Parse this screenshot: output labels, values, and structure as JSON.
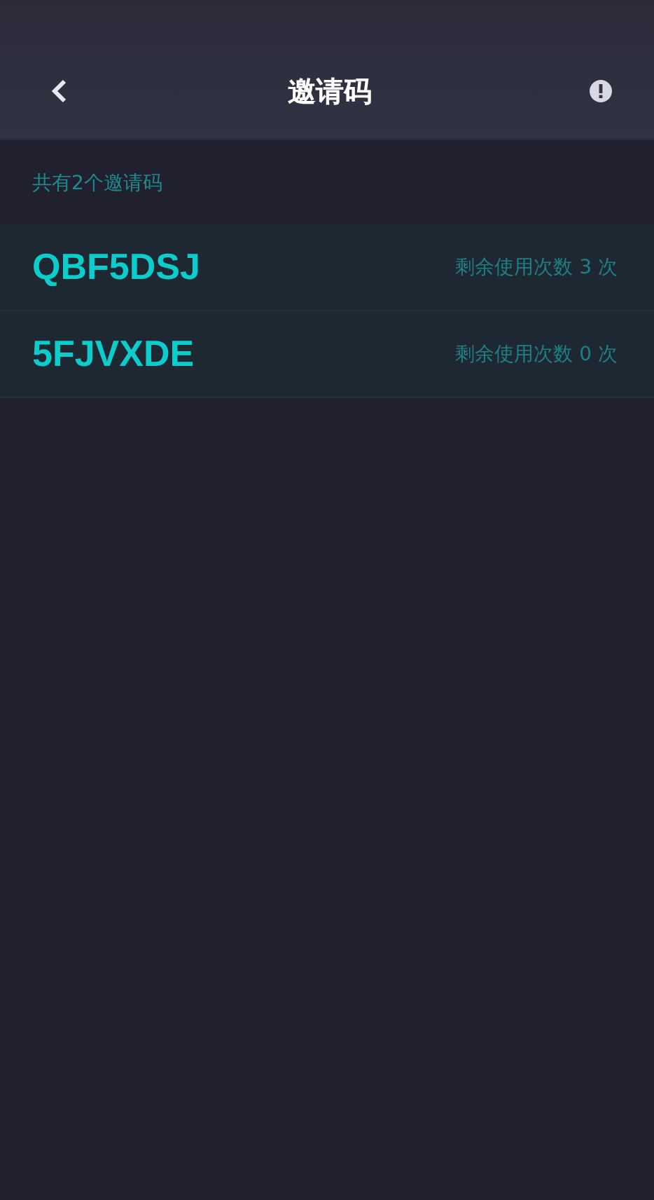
{
  "header": {
    "title": "邀请码"
  },
  "summary": "共有2个邀请码",
  "codes": [
    {
      "code": "QBF5DSJ",
      "remaining": "剩余使用次数 3 次"
    },
    {
      "code": "5FJVXDE",
      "remaining": "剩余使用次数 0 次"
    }
  ]
}
